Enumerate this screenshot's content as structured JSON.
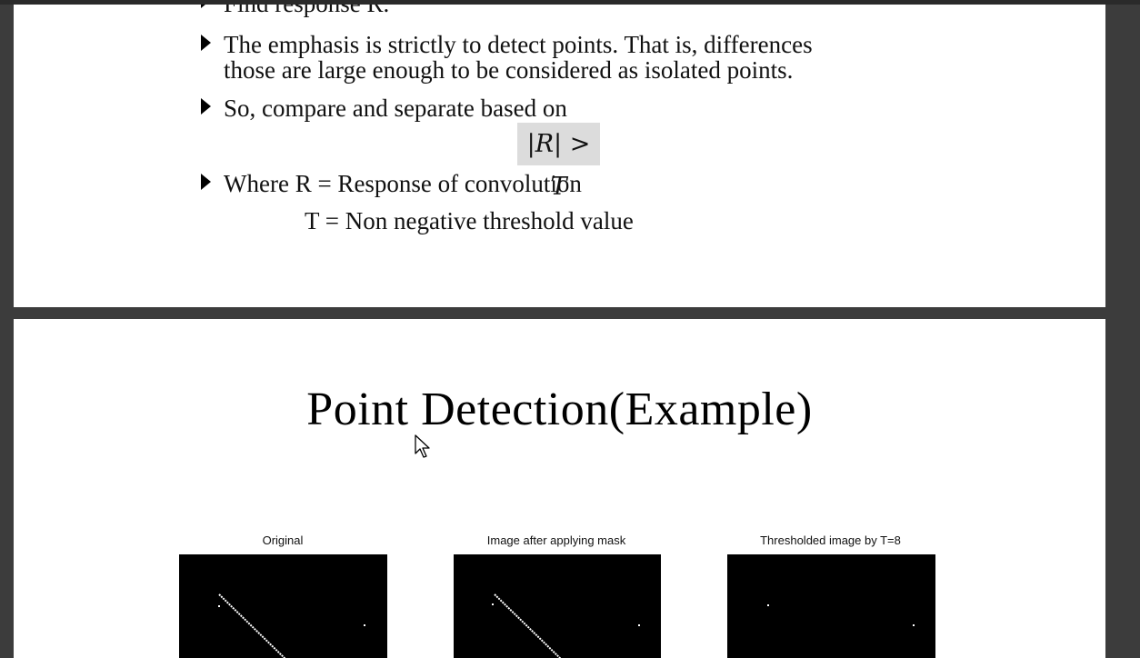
{
  "page1": {
    "bullets": [
      {
        "text": "Find response R."
      },
      {
        "line1": "The emphasis is strictly to detect points. That is, differences",
        "line2": "those are large enough to be considered as isolated points."
      },
      {
        "text": "So, compare and separate based on"
      },
      {
        "text": "Where R = Response of convolution"
      }
    ],
    "formula": "|R| > T",
    "continuation": "T = Non negative threshold value"
  },
  "page2": {
    "title": "Point Detection(Example)",
    "figures": [
      {
        "caption": "Original"
      },
      {
        "caption": "Image after applying mask"
      },
      {
        "caption": "Thresholded image by T=8"
      }
    ]
  },
  "colors": {
    "viewer_bg": "#3c3c3c",
    "page_bg": "#ffffff",
    "formula_bg": "#dcdcdc",
    "image_bg": "#000000"
  },
  "icons": {
    "bullet": "triangle-right-icon",
    "cursor": "mouse-pointer-icon"
  }
}
